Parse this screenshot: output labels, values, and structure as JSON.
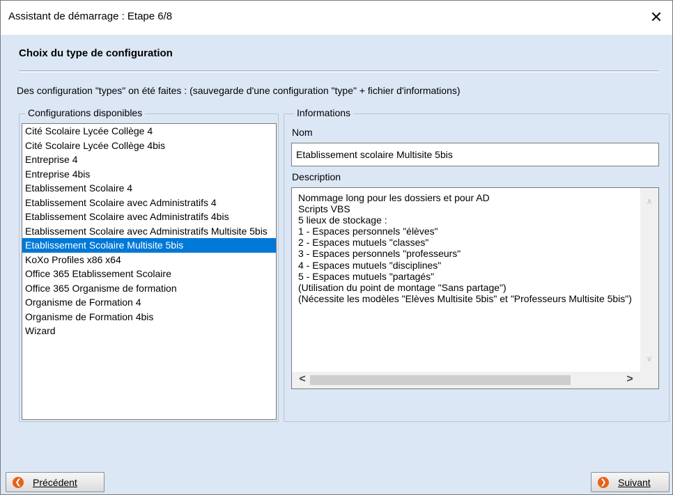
{
  "window": {
    "title": "Assistant de démarrage : Etape 6/8",
    "close_glyph": "✕"
  },
  "page": {
    "heading": "Choix du type de configuration",
    "intro": "Des configuration \"types\" on été faites : (sauvegarde d'une configuration \"type\" + fichier d'informations)"
  },
  "configurations": {
    "legend": "Configurations disponibles",
    "items": [
      "Cité Scolaire Lycée Collège 4",
      "Cité Scolaire Lycée Collège 4bis",
      "Entreprise 4",
      "Entreprise 4bis",
      "Etablissement Scolaire 4",
      "Etablissement Scolaire avec Administratifs 4",
      "Etablissement Scolaire avec Administratifs 4bis",
      "Etablissement Scolaire avec Administratifs Multisite 5bis",
      "Etablissement Scolaire Multisite 5bis",
      "KoXo Profiles x86 x64",
      "Office 365 Etablissement Scolaire",
      "Office 365 Organisme de formation",
      "Organisme de Formation 4",
      "Organisme de Formation 4bis",
      "Wizard"
    ],
    "selected_index": 8
  },
  "informations": {
    "legend": "Informations",
    "name_label": "Nom",
    "name_value": "Etablissement scolaire Multisite 5bis",
    "description_label": "Description",
    "description_lines": [
      "Nommage long pour les dossiers et pour AD",
      "Scripts VBS",
      "5 lieux de stockage :",
      "1 - Espaces personnels \"élèves\"",
      "2 - Espaces mutuels \"classes\"",
      "3 - Espaces personnels \"professeurs\"",
      "4 - Espaces mutuels \"disciplines\"",
      "5 - Espaces mutuels \"partagés\"",
      "(Utilisation du point de montage \"Sans partage\")",
      "(Nécessite les modèles \"Elèves Multisite 5bis\" et \"Professeurs Multisite 5bis\")"
    ],
    "scroll": {
      "up": "∧",
      "down": "∨",
      "left": "<",
      "right": ">"
    }
  },
  "buttons": {
    "previous_label": "Précédent",
    "next_label": "Suivant",
    "previous_icon": "arrow-left-icon",
    "next_icon": "arrow-right-icon"
  },
  "colors": {
    "window_bg": "#dce7f5",
    "selection": "#0078d7",
    "button_icon": "#e8611a"
  }
}
